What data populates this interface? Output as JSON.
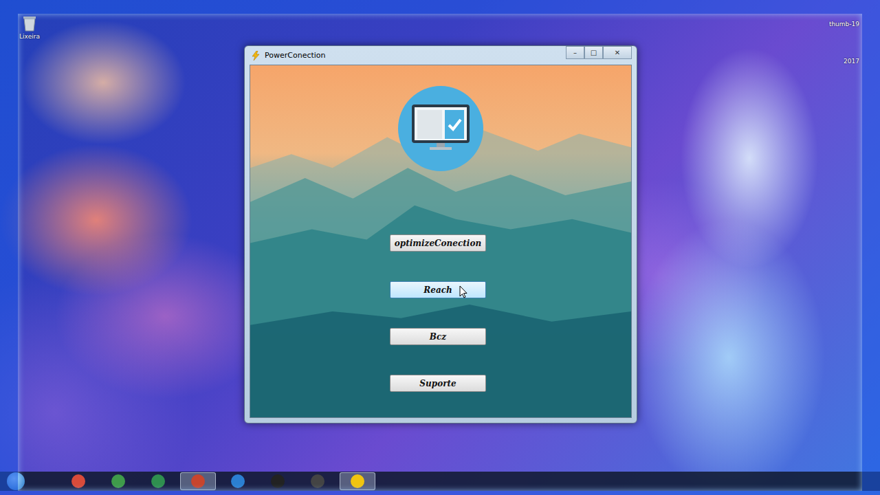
{
  "window": {
    "title": "PowerConection",
    "controls": [
      "–",
      "□",
      "✕"
    ]
  },
  "desktop_icons": [
    {
      "label": "Lixeira"
    }
  ],
  "desktop_labels": [
    "thumb-19",
    "2017"
  ],
  "buttons": [
    {
      "label": "optimizeConection",
      "hovered": false
    },
    {
      "label": "Reach",
      "hovered": true
    },
    {
      "label": "Bcz",
      "hovered": false
    },
    {
      "label": "Suporte",
      "hovered": false
    }
  ],
  "taskbar": {
    "apps": [
      {
        "kind": "chrome",
        "selected": false
      },
      {
        "kind": "folder",
        "selected": false
      },
      {
        "kind": "media",
        "selected": false
      },
      {
        "kind": "paint",
        "selected": true
      },
      {
        "kind": "store",
        "selected": false
      },
      {
        "kind": "google",
        "selected": false
      },
      {
        "kind": "globe",
        "selected": false
      },
      {
        "kind": "power",
        "selected": true
      }
    ]
  }
}
